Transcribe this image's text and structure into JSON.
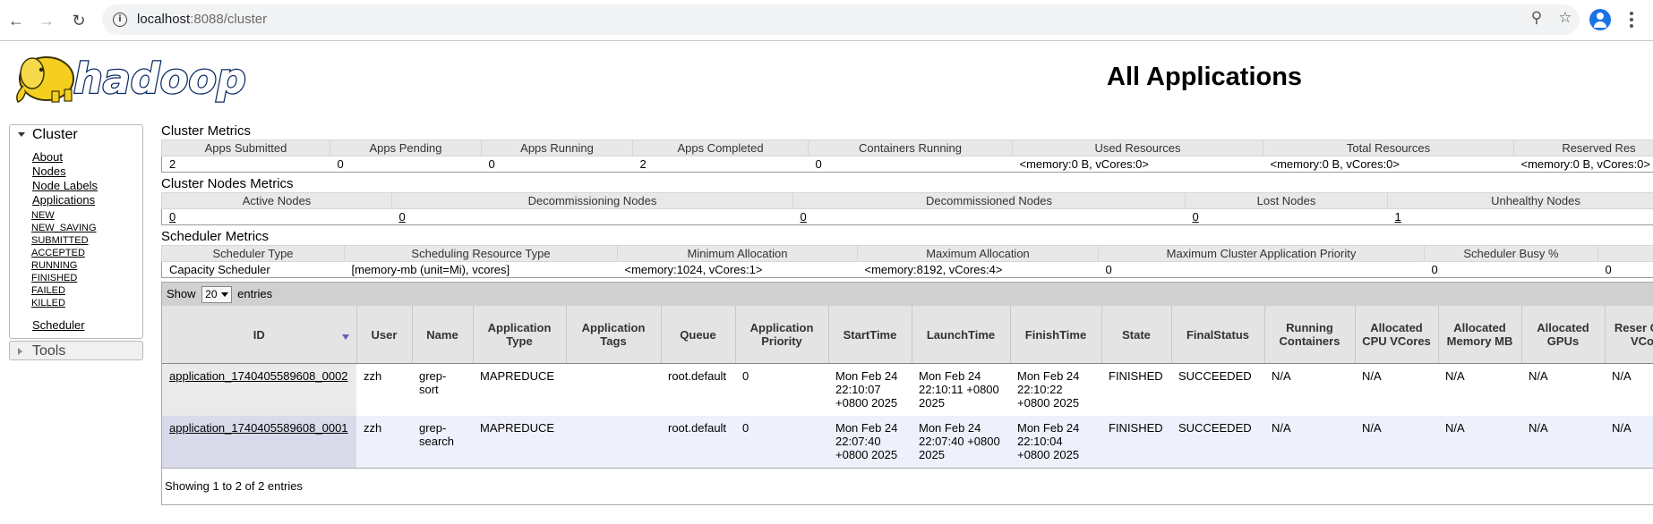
{
  "browser": {
    "url_host": "localhost",
    "url_rest": ":8088/cluster"
  },
  "header": {
    "logo_text": "hadoop",
    "title": "All Applications"
  },
  "sidebar": {
    "cluster_label": "Cluster",
    "items": [
      "About",
      "Nodes",
      "Node Labels",
      "Applications"
    ],
    "app_states": [
      "NEW",
      "NEW_SAVING",
      "SUBMITTED",
      "ACCEPTED",
      "RUNNING",
      "FINISHED",
      "FAILED",
      "KILLED"
    ],
    "scheduler": "Scheduler",
    "tools_label": "Tools"
  },
  "cluster_metrics": {
    "title": "Cluster Metrics",
    "headers": [
      "Apps Submitted",
      "Apps Pending",
      "Apps Running",
      "Apps Completed",
      "Containers Running",
      "Used Resources",
      "Total Resources",
      "Reserved Res"
    ],
    "values": [
      "2",
      "0",
      "0",
      "2",
      "0",
      "<memory:0 B, vCores:0>",
      "<memory:0 B, vCores:0>",
      "<memory:0 B, vCores:0>"
    ]
  },
  "node_metrics": {
    "title": "Cluster Nodes Metrics",
    "headers": [
      "Active Nodes",
      "Decommissioning Nodes",
      "Decommissioned Nodes",
      "Lost Nodes",
      "Unhealthy Nodes"
    ],
    "values": [
      "0",
      "0",
      "0",
      "0",
      "1"
    ]
  },
  "scheduler_metrics": {
    "title": "Scheduler Metrics",
    "headers": [
      "Scheduler Type",
      "Scheduling Resource Type",
      "Minimum Allocation",
      "Maximum Allocation",
      "Maximum Cluster Application Priority",
      "Scheduler Busy %",
      ""
    ],
    "values": [
      "Capacity Scheduler",
      "[memory-mb (unit=Mi), vcores]",
      "<memory:1024, vCores:1>",
      "<memory:8192, vCores:4>",
      "0",
      "0",
      "0"
    ]
  },
  "apps": {
    "show_label": "Show",
    "page_size": "20",
    "entries_label": "entries",
    "columns": [
      "ID",
      "User",
      "Name",
      "Application Type",
      "Application Tags",
      "Queue",
      "Application Priority",
      "StartTime",
      "LaunchTime",
      "FinishTime",
      "State",
      "FinalStatus",
      "Running Containers",
      "Allocated CPU VCores",
      "Allocated Memory MB",
      "Allocated GPUs",
      "Reser CPU VCor"
    ],
    "rows": [
      [
        "application_1740405589608_0002",
        "zzh",
        "grep-sort",
        "MAPREDUCE",
        "",
        "root.default",
        "0",
        "Mon Feb 24 22:10:07 +0800 2025",
        "Mon Feb 24 22:10:11 +0800 2025",
        "Mon Feb 24 22:10:22 +0800 2025",
        "FINISHED",
        "SUCCEEDED",
        "N/A",
        "N/A",
        "N/A",
        "N/A",
        "N/A"
      ],
      [
        "application_1740405589608_0001",
        "zzh",
        "grep-search",
        "MAPREDUCE",
        "",
        "root.default",
        "0",
        "Mon Feb 24 22:07:40 +0800 2025",
        "Mon Feb 24 22:07:40 +0800 2025",
        "Mon Feb 24 22:10:04 +0800 2025",
        "FINISHED",
        "SUCCEEDED",
        "N/A",
        "N/A",
        "N/A",
        "N/A",
        "N/A"
      ]
    ],
    "footer": "Showing 1 to 2 of 2 entries"
  }
}
